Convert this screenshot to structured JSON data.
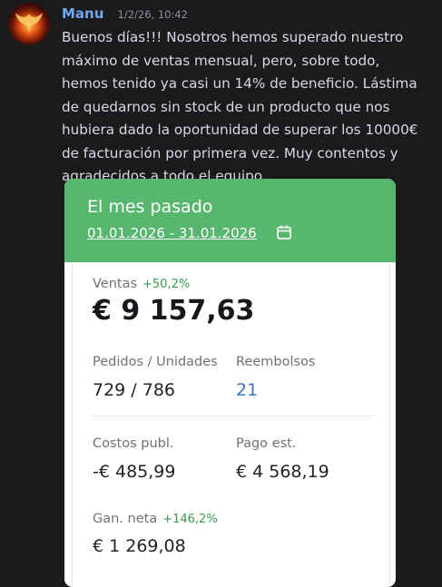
{
  "message": {
    "username": "Manu",
    "timestamp": "1/2/26, 10:42",
    "text": "Buenos días!!! Nosotros hemos superado nuestro máximo de ventas mensual, pero, sobre todo, hemos tenido ya casi un 14% de beneficio. Lástima de quedarnos sin stock de un producto que nos hubiera dado la oportunidad de superar los 10000€ de facturación por primera vez. Muy contentos y agradecidos a todo el equipo."
  },
  "card": {
    "title": "El mes pasado",
    "date_range": "01.01.2026 - 31.01.2026",
    "calendar_icon": "calendar-icon",
    "sales": {
      "label": "Ventas",
      "change": "+50,2%",
      "value": "€ 9 157,63"
    },
    "orders": {
      "label": "Pedidos / Unidades",
      "value": "729 / 786"
    },
    "refunds": {
      "label": "Reembolsos",
      "value": "21"
    },
    "ad_costs": {
      "label": "Costos publ.",
      "value": "-€ 485,99"
    },
    "payout": {
      "label": "Pago est.",
      "value": "€ 4 568,19"
    },
    "net_profit": {
      "label": "Gan. neta",
      "change": "+146,2%",
      "value": "€ 1 269,08"
    }
  },
  "colors": {
    "background": "#1b1b1e",
    "username": "#72a8f0",
    "card_header": "#58b76f",
    "positive_change": "#3a9a4e",
    "refund_value": "#3b74c2"
  }
}
